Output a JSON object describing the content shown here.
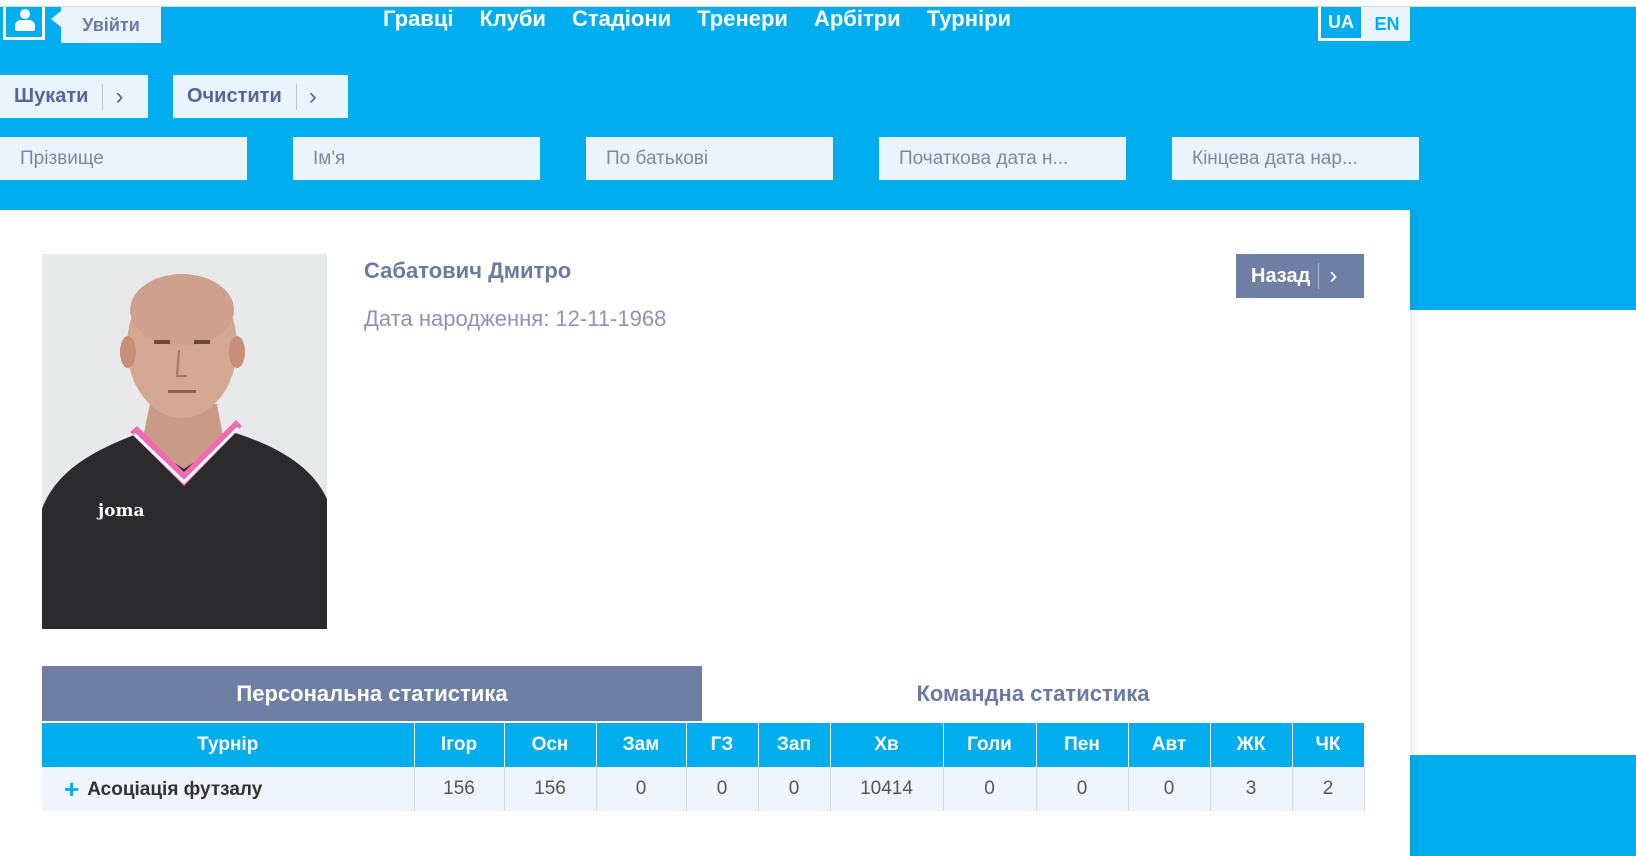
{
  "header": {
    "login_label": "Увійти",
    "nav": [
      "Гравці",
      "Клуби",
      "Стадіони",
      "Тренери",
      "Арбітри",
      "Турніри"
    ],
    "languages": {
      "ua": "UA",
      "en": "EN"
    },
    "search_label": "Шукати",
    "clear_label": "Очистити",
    "fields": [
      {
        "placeholder": "Прізвище"
      },
      {
        "placeholder": "Ім'я"
      },
      {
        "placeholder": "По батькові"
      },
      {
        "placeholder": "Початкова дата н..."
      },
      {
        "placeholder": "Кінцева дата нар..."
      }
    ]
  },
  "profile": {
    "name": "Сабатович Дмитро",
    "birth_text": "Дата народження: 12-11-1968",
    "back_label": "Назад",
    "shirt_logo": "joma"
  },
  "tabs": {
    "personal": "Персональна статистика",
    "team": "Командна статистика"
  },
  "stats": {
    "headers": [
      "Турнір",
      "Ігор",
      "Осн",
      "Зам",
      "ГЗ",
      "Зап",
      "Хв",
      "Голи",
      "Пен",
      "Авт",
      "ЖК",
      "ЧК"
    ],
    "rows": [
      {
        "tournament": "Асоціація футзалу",
        "values": [
          "156",
          "156",
          "0",
          "0",
          "0",
          "10414",
          "0",
          "0",
          "0",
          "3",
          "2"
        ]
      }
    ]
  },
  "colors": {
    "accent": "#00adef",
    "slate": "#6f7ea3",
    "light": "#eaf4fc"
  },
  "icons": {
    "user": "user-icon",
    "chevron": "chevron-right-icon",
    "expand": "plus-icon"
  }
}
